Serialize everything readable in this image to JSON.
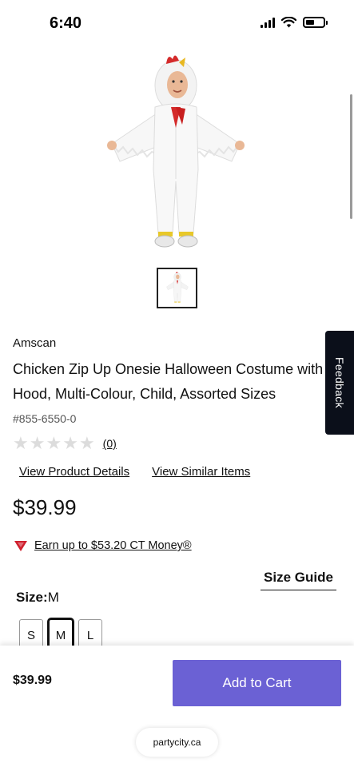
{
  "status_bar": {
    "time": "6:40"
  },
  "product": {
    "brand": "Amscan",
    "title": "Chicken Zip Up Onesie Halloween Costume with\nHood, Multi-Colour, Child, Assorted Sizes",
    "sku": "#855-6550-0",
    "rating": {
      "stars_filled": 0,
      "stars_total": 5,
      "review_count": "(0)"
    },
    "links": {
      "details": "View Product Details",
      "similar": "View Similar Items"
    },
    "price": "$39.99",
    "ct_money": "Earn up to $53.20 CT Money®",
    "size_guide": "Size Guide",
    "size": {
      "label": "Size:",
      "selected": "M",
      "options": [
        "S",
        "M",
        "L"
      ]
    }
  },
  "bottom_bar": {
    "price": "$39.99",
    "add_to_cart": "Add to Cart",
    "domain": "partycity.ca"
  },
  "feedback": {
    "label": "Feedback"
  },
  "colors": {
    "accent": "#6b61d4",
    "ct_red": "#d0202e",
    "feedback_bg": "#0b0f1a"
  }
}
